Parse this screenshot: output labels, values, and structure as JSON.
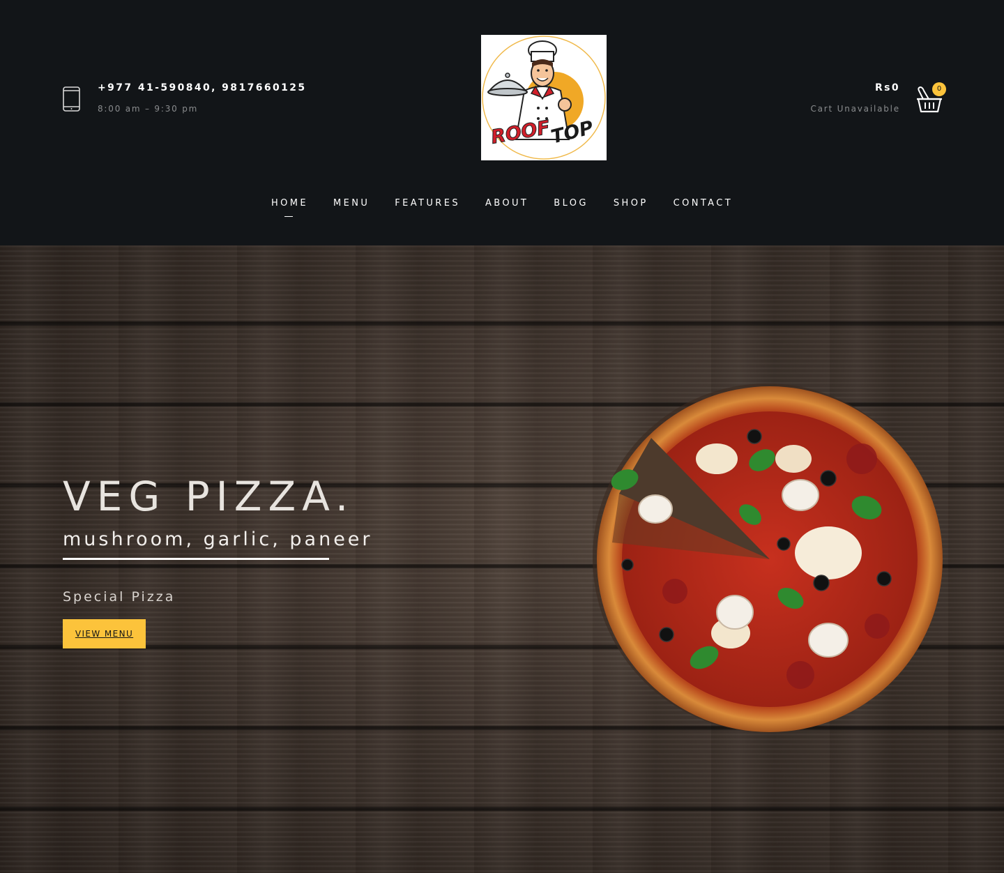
{
  "header": {
    "phone": "+977 41-590840, 9817660125",
    "hours": "8:00 am – 9:30 pm",
    "logo": {
      "line1": "ROOF",
      "line2": "TOP"
    },
    "cart": {
      "amount": "Rs0",
      "status": "Cart Unavailable",
      "count": "0"
    }
  },
  "nav": {
    "items": [
      {
        "label": "HOME",
        "active": true
      },
      {
        "label": "MENU"
      },
      {
        "label": "FEATURES"
      },
      {
        "label": "ABOUT"
      },
      {
        "label": "BLOG"
      },
      {
        "label": "SHOP"
      },
      {
        "label": "CONTACT"
      }
    ]
  },
  "hero": {
    "title": "VEG PIZZA.",
    "subtitle": "mushroom, garlic, paneer",
    "tag": "Special Pizza",
    "button": "VIEW MENU"
  },
  "colors": {
    "background": "#121518",
    "accent": "#fcc33b",
    "muted_text": "#8a8c8e"
  },
  "icons": [
    "phone-icon",
    "basket-icon",
    "chef-logo",
    "pizza-image"
  ]
}
